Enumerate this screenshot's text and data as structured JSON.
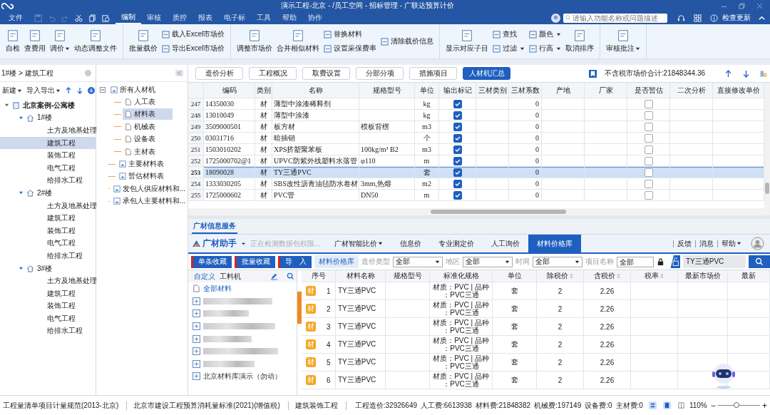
{
  "window": {
    "title": "演示工程-北京 - /员工空间 - 招标管理 - 广联达预算计价"
  },
  "menu": [
    {
      "label": "文件",
      "selected": false
    },
    {
      "label": "编制",
      "selected": true
    },
    {
      "label": "审核",
      "selected": false
    },
    {
      "label": "质控",
      "selected": false
    },
    {
      "label": "报表",
      "selected": false
    },
    {
      "label": "电子标",
      "selected": false
    },
    {
      "label": "工具",
      "selected": false
    },
    {
      "label": "帮助",
      "selected": false
    },
    {
      "label": "协作",
      "selected": false
    }
  ],
  "search": {
    "placeholder": "请输入功能名称或问题描述"
  },
  "update_button": "检查更新",
  "ribbon": [
    {
      "items": [
        {
          "kind": "large",
          "label": "自检",
          "dropdown": false
        },
        {
          "kind": "large",
          "label": "查费用",
          "dropdown": false
        },
        {
          "kind": "large",
          "label": "调价",
          "dropdown": true
        },
        {
          "kind": "large",
          "label": "动态调整文件",
          "dropdown": false
        }
      ]
    },
    {
      "items": [
        {
          "kind": "large",
          "label": "批量载价",
          "dropdown": false
        },
        {
          "kind": "stack",
          "items": [
            {
              "label": "载入Excel市场价",
              "dropdown": false
            },
            {
              "label": "导出Excel市场价",
              "dropdown": false
            }
          ]
        }
      ]
    },
    {
      "items": [
        {
          "kind": "large",
          "label": "调整市场价",
          "dropdown": false
        },
        {
          "kind": "large",
          "label": "合并相似材料",
          "dropdown": false
        },
        {
          "kind": "stack",
          "items": [
            {
              "label": "替换材料",
              "dropdown": false
            },
            {
              "label": "设置采保费率",
              "dropdown": false
            }
          ]
        },
        {
          "kind": "stack",
          "items": [
            {
              "label": "清除载价信息",
              "dropdown": false
            }
          ]
        }
      ]
    },
    {
      "items": [
        {
          "kind": "large",
          "label": "显示对应子目",
          "dropdown": false
        },
        {
          "kind": "stack",
          "items": [
            {
              "label": "查找",
              "dropdown": false
            },
            {
              "label": "过滤",
              "dropdown": true
            }
          ]
        },
        {
          "kind": "stack",
          "items": [
            {
              "label": "颜色",
              "dropdown": true
            },
            {
              "label": "行高",
              "dropdown": true
            }
          ]
        },
        {
          "kind": "large",
          "label": "取消排序",
          "dropdown": false
        }
      ]
    },
    {
      "items": [
        {
          "kind": "large",
          "label": "审核批注",
          "dropdown": true
        }
      ]
    }
  ],
  "breadcrumb": "1#楼 > 建筑工程",
  "left_toolbar": [
    {
      "label": "新建",
      "dropdown": true
    },
    {
      "label": "导入导出",
      "dropdown": true
    }
  ],
  "project_tree": [
    {
      "label": "北京案例-公寓楼",
      "kind": "building",
      "expanded": true,
      "selected": false,
      "children": [
        {
          "label": "1#楼",
          "kind": "house",
          "expanded": true,
          "selected": false,
          "children": [
            {
              "label": "土方及地基处理",
              "selected": false
            },
            {
              "label": "建筑工程",
              "selected": true
            },
            {
              "label": "装饰工程",
              "selected": false
            },
            {
              "label": "电气工程",
              "selected": false
            },
            {
              "label": "给排水工程",
              "selected": false
            }
          ]
        },
        {
          "label": "2#楼",
          "kind": "house",
          "expanded": true,
          "selected": false,
          "children": [
            {
              "label": "土方及地基处理",
              "selected": false
            },
            {
              "label": "建筑工程",
              "selected": false
            },
            {
              "label": "装饰工程",
              "selected": false
            },
            {
              "label": "电气工程",
              "selected": false
            },
            {
              "label": "给排水工程",
              "selected": false
            }
          ]
        },
        {
          "label": "3#楼",
          "kind": "house",
          "expanded": true,
          "selected": false,
          "children": [
            {
              "label": "土方及地基处理",
              "selected": false
            },
            {
              "label": "建筑工程",
              "selected": false
            },
            {
              "label": "装饰工程",
              "selected": false
            },
            {
              "label": "电气工程",
              "selected": false
            },
            {
              "label": "给排水工程",
              "selected": false
            }
          ]
        }
      ]
    }
  ],
  "material_tree": [
    {
      "label": "所有人材机",
      "kind": "sheet",
      "expanded": true,
      "selected": false,
      "children": [
        {
          "label": "人工表",
          "kind": "page",
          "selected": false
        },
        {
          "label": "材料表",
          "kind": "page",
          "selected": true
        },
        {
          "label": "机械表",
          "kind": "page",
          "selected": false
        },
        {
          "label": "设备表",
          "kind": "page",
          "selected": false
        },
        {
          "label": "主材表",
          "kind": "page",
          "selected": false
        }
      ]
    },
    {
      "label": "主要材料表",
      "kind": "sheet",
      "selected": false
    },
    {
      "label": "暂估材料表",
      "kind": "sheet",
      "selected": false
    },
    {
      "label": "发包人供应材料和...",
      "kind": "sheet",
      "selected": false
    },
    {
      "label": "承包人主要材料和...",
      "kind": "sheet",
      "selected": false
    }
  ],
  "view_tabs": [
    {
      "label": "造价分析",
      "selected": false
    },
    {
      "label": "工程概况",
      "selected": false
    },
    {
      "label": "取费设置",
      "selected": false
    },
    {
      "label": "分部分项",
      "selected": false
    },
    {
      "label": "措施项目",
      "selected": false
    },
    {
      "label": "人材机汇总",
      "selected": true
    }
  ],
  "total": "不含税市场价合计:21848344.36",
  "table": {
    "columns": [
      "编码",
      "类别",
      "名称",
      "规格型号",
      "单位",
      "输出标记",
      "三材类别",
      "三材系数",
      "产地",
      "厂家",
      "是否暂估",
      "二次分析",
      "直接修改单价"
    ],
    "rows": [
      {
        "no": "247",
        "code": "14350030",
        "type": "材",
        "name": "薄型中涂漆稀释剂",
        "spec": "",
        "unit": "kg",
        "output": true,
        "coef": "0",
        "estimate": false,
        "selected": false
      },
      {
        "no": "248",
        "code": "13010049",
        "type": "材",
        "name": "薄型中涂漆",
        "spec": "",
        "unit": "kg",
        "output": true,
        "coef": "0",
        "estimate": false,
        "selected": false
      },
      {
        "no": "249",
        "code": "3509000501",
        "type": "材",
        "name": "板方材",
        "spec": "模板背楞",
        "unit": "m3",
        "output": true,
        "coef": "0",
        "estimate": false,
        "selected": false
      },
      {
        "no": "250",
        "code": "03031716",
        "type": "材",
        "name": "暗插销",
        "spec": "",
        "unit": "个",
        "output": true,
        "coef": "0",
        "estimate": false,
        "selected": false
      },
      {
        "no": "251",
        "code": "1503010202",
        "type": "材",
        "name": "XPS挤塑聚苯板",
        "spec": "100kg/m³ B2",
        "unit": "m3",
        "output": true,
        "coef": "0",
        "estimate": false,
        "selected": false
      },
      {
        "no": "252",
        "code": "1725000702@1",
        "type": "材",
        "name": "UPVC防紫外线塑料水落管",
        "spec": "φ110",
        "unit": "m",
        "output": true,
        "coef": "0",
        "estimate": false,
        "selected": false
      },
      {
        "no": "253",
        "code": "18090028",
        "type": "材",
        "name": "TY三通PVC",
        "spec": "",
        "unit": "套",
        "output": true,
        "coef": "0",
        "estimate": false,
        "selected": true
      },
      {
        "no": "254",
        "code": "1333030205",
        "type": "材",
        "name": "SBS改性沥青油毡防水卷材",
        "spec": "3mm,热熔",
        "unit": "m2",
        "output": true,
        "coef": "0",
        "estimate": false,
        "selected": false
      },
      {
        "no": "255",
        "code": "1725000602",
        "type": "材",
        "name": "PVC管",
        "spec": "DN50",
        "unit": "m",
        "output": true,
        "coef": "0",
        "estimate": false,
        "selected": false
      }
    ]
  },
  "info_panel": {
    "tab": "广材信息服务",
    "brand": "广材助手",
    "status": "正在检测数据包权限...",
    "nav": [
      {
        "label": "广材智能比价",
        "dropdown": true,
        "selected": false
      },
      {
        "label": "信息价",
        "dropdown": false,
        "selected": false
      },
      {
        "label": "专业测定价",
        "dropdown": false,
        "selected": false
      },
      {
        "label": "人工询价",
        "dropdown": false,
        "selected": false
      },
      {
        "label": "材料价格库",
        "dropdown": false,
        "selected": true
      }
    ],
    "links": [
      {
        "label": "反馈",
        "dropdown": false
      },
      {
        "label": "消息",
        "dropdown": false
      },
      {
        "label": "帮助",
        "dropdown": true
      }
    ],
    "actions": [
      "单条收藏",
      "批量收藏",
      "导　入"
    ],
    "library_label": "材料价格库",
    "filters": [
      {
        "label": "造价类型",
        "value": "全部"
      },
      {
        "label": "地区",
        "value": "全部"
      },
      {
        "label": "时间",
        "value": "全部"
      }
    ],
    "project_name": {
      "label": "项目名称",
      "value": "全部"
    },
    "query": "TY三通PVC",
    "side_tabs": [
      {
        "label": "自定义",
        "selected": true
      },
      {
        "label": "工料机",
        "selected": false
      }
    ],
    "side_items": [
      {
        "kind": "all",
        "label": "全部材料"
      },
      {
        "kind": "blurred"
      },
      {
        "kind": "blurred"
      },
      {
        "kind": "blurred"
      },
      {
        "kind": "blurred"
      },
      {
        "kind": "blurred"
      },
      {
        "kind": "blurred"
      },
      {
        "kind": "group",
        "label": "北京材料库演示（勿动）"
      }
    ],
    "columns": [
      {
        "label": "序号",
        "sortable": false
      },
      {
        "label": "材料名称",
        "sortable": false
      },
      {
        "label": "规格型号",
        "sortable": false
      },
      {
        "label": "标准化规格",
        "sortable": false
      },
      {
        "label": "单位",
        "sortable": false
      },
      {
        "label": "除税价",
        "sortable": true
      },
      {
        "label": "含税价",
        "sortable": true
      },
      {
        "label": "税率",
        "sortable": true
      },
      {
        "label": "最新市场价",
        "sortable": false
      },
      {
        "label": "最新",
        "sortable": false
      }
    ],
    "rows": [
      {
        "tag": "材",
        "no": "1",
        "name": "TY三通PVC",
        "spec": [
          "材质：PVC | 品种",
          "：PVC三通"
        ],
        "unit": "套",
        "price": "2",
        "tax_price": "2.26"
      },
      {
        "tag": "材",
        "no": "2",
        "name": "TY三通PVC",
        "spec": [
          "材质：PVC | 品种",
          "：PVC三通"
        ],
        "unit": "套",
        "price": "2",
        "tax_price": "2.26"
      },
      {
        "tag": "材",
        "no": "3",
        "name": "TY三通PVC",
        "spec": [
          "材质：PVC | 品种",
          "：PVC三通"
        ],
        "unit": "套",
        "price": "2",
        "tax_price": "2.26"
      },
      {
        "tag": "材",
        "no": "4",
        "name": "TY三通PVC",
        "spec": [
          "材质：PVC | 品种",
          "：PVC三通"
        ],
        "unit": "套",
        "price": "2",
        "tax_price": "2.26"
      },
      {
        "tag": "材",
        "no": "5",
        "name": "TY三通PVC",
        "spec": [
          "材质：PVC | 品种",
          "：PVC三通"
        ],
        "unit": "套",
        "price": "2",
        "tax_price": "2.26"
      },
      {
        "tag": "材",
        "no": "6",
        "name": "TY三通PVC",
        "spec": [
          "材质：PVC | 品种",
          "：PVC三通"
        ],
        "unit": "套",
        "price": "2",
        "tax_price": "2.26"
      }
    ]
  },
  "status_bar": {
    "left": [
      "工程量清单项目计量规范(2013-北京)",
      "北京市建设工程预算消耗量标准(2021)(增值税)",
      "建筑装饰工程"
    ],
    "fees": [
      "工程造价:32926649",
      "人工费:6613938",
      "材料费:21848382",
      "机械费:197149",
      "设备费:0",
      "主材费:0"
    ],
    "zoom": "110%",
    "zoom_out": "−",
    "zoom_in": "+",
    "zoom_slider": {
      "level": 0.45
    }
  }
}
